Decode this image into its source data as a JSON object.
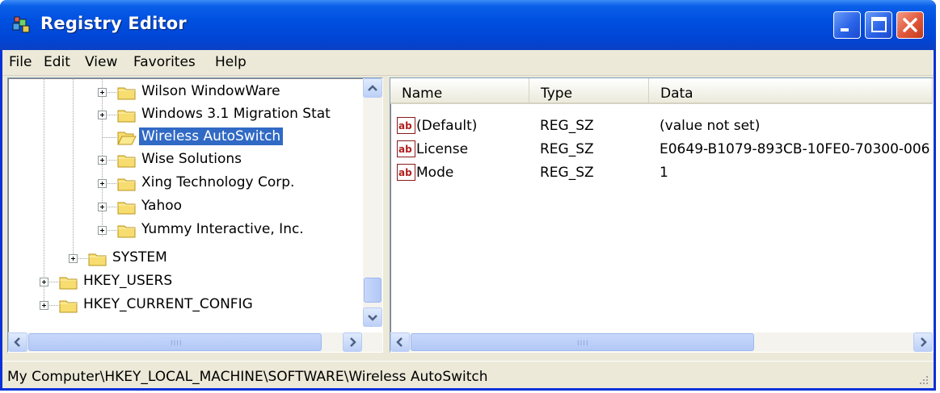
{
  "window": {
    "title": "Registry Editor"
  },
  "menu": {
    "items": [
      "File",
      "Edit",
      "View",
      "Favorites",
      "Help"
    ]
  },
  "tree": {
    "nodes": [
      {
        "label": "Wilson WindowWare",
        "expandable": true,
        "selected": false
      },
      {
        "label": "Windows 3.1 Migration Stat",
        "expandable": true,
        "selected": false
      },
      {
        "label": "Wireless AutoSwitch",
        "expandable": false,
        "selected": true
      },
      {
        "label": "Wise Solutions",
        "expandable": true,
        "selected": false
      },
      {
        "label": "Xing Technology Corp.",
        "expandable": true,
        "selected": false
      },
      {
        "label": "Yahoo",
        "expandable": true,
        "selected": false
      },
      {
        "label": "Yummy Interactive, Inc.",
        "expandable": true,
        "selected": false
      },
      {
        "label": "SYSTEM",
        "expandable": true,
        "selected": false
      },
      {
        "label": "HKEY_USERS",
        "expandable": true,
        "selected": false
      },
      {
        "label": "HKEY_CURRENT_CONFIG",
        "expandable": true,
        "selected": false
      }
    ]
  },
  "list": {
    "columns": [
      "Name",
      "Type",
      "Data"
    ],
    "rows": [
      {
        "name": "(Default)",
        "type": "REG_SZ",
        "data": "(value not set)",
        "icon": "string-value-icon"
      },
      {
        "name": "License",
        "type": "REG_SZ",
        "data": "E0649-B1079-893CB-10FE0-70300-006",
        "icon": "string-value-icon"
      },
      {
        "name": "Mode",
        "type": "REG_SZ",
        "data": "1",
        "icon": "string-value-icon"
      }
    ]
  },
  "status": {
    "path": "My Computer\\HKEY_LOCAL_MACHINE\\SOFTWARE\\Wireless AutoSwitch"
  },
  "colors": {
    "titlebar": "#0050e0",
    "selection": "#316ac5",
    "close_button": "#e0563a",
    "chrome": "#ece9d8"
  }
}
